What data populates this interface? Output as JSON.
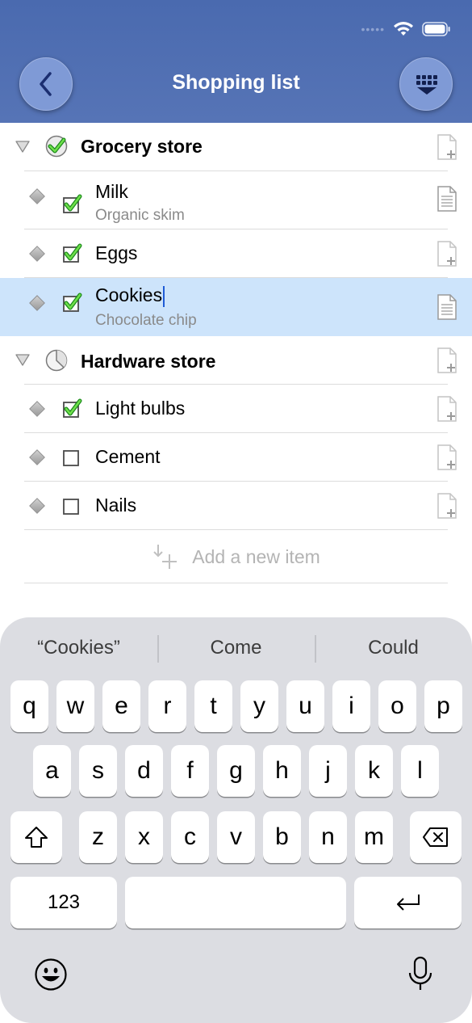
{
  "header": {
    "title": "Shopping list",
    "status_dots": "•••••",
    "back_icon": "chevron-left-icon",
    "menu_icon": "grid-dropdown-icon",
    "header_color": "#4f6fb3",
    "button_color": "#7f9ad6"
  },
  "groups": [
    {
      "name": "Grocery store",
      "status_icon": "check-circle-icon",
      "items": [
        {
          "name": "Milk",
          "note": "Organic skim",
          "checked": true
        },
        {
          "name": "Eggs",
          "note": "",
          "checked": true
        },
        {
          "name": "Cookies",
          "note": "Chocolate chip",
          "checked": true,
          "selected": true
        }
      ]
    },
    {
      "name": "Hardware store",
      "status_icon": "partial-pie-icon",
      "items": [
        {
          "name": "Light bulbs",
          "note": "",
          "checked": true
        },
        {
          "name": "Cement",
          "note": "",
          "checked": false
        },
        {
          "name": "Nails",
          "note": "",
          "checked": false
        }
      ]
    }
  ],
  "add_item": {
    "label": "Add a new item"
  },
  "keyboard": {
    "suggestions": [
      "“Cookies”",
      "Come",
      "Could"
    ],
    "row1": [
      "q",
      "w",
      "e",
      "r",
      "t",
      "y",
      "u",
      "i",
      "o",
      "p"
    ],
    "row2": [
      "a",
      "s",
      "d",
      "f",
      "g",
      "h",
      "j",
      "k",
      "l"
    ],
    "row3": [
      "z",
      "x",
      "c",
      "v",
      "b",
      "n",
      "m"
    ],
    "numbers_key": "123",
    "shift_icon": "shift-arrow-icon",
    "delete_icon": "backspace-icon",
    "return_icon": "return-arrow-icon",
    "emoji_icon": "emoji-face-icon",
    "mic_icon": "microphone-icon"
  }
}
